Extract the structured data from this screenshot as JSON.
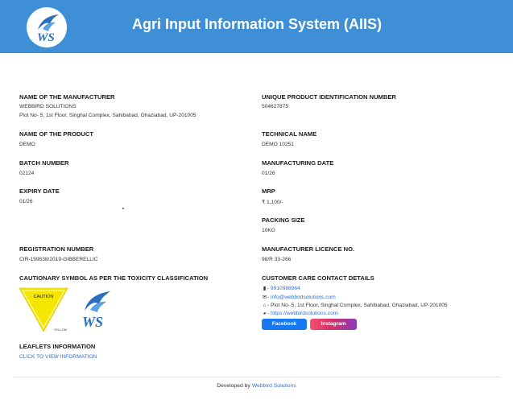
{
  "header": {
    "title": "Agri Input Information System (AIIS)"
  },
  "fields": {
    "manufacturer": {
      "label": "NAME OF THE MANUFACTURER",
      "name": "WEBBIRD SOLUTIONS",
      "address": "Plot No- 5, 1st Floor, Singhal Complex, Sahibabad, Ghaziabad, UP-201005"
    },
    "upin": {
      "label": "UNIQUE PRODUCT IDENTIFICATION NUMBER",
      "value": "504627875"
    },
    "product": {
      "label": "NAME OF THE PRODUCT",
      "value": "DEMO"
    },
    "technical": {
      "label": "TECHNICAL NAME",
      "value": "DEMO 10251"
    },
    "batch": {
      "label": "BATCH NUMBER",
      "value": "02124"
    },
    "mfg_date": {
      "label": "MANUFACTURING DATE",
      "value": "01/26"
    },
    "expiry": {
      "label": "EXPIRY DATE",
      "value": "01/26"
    },
    "mrp": {
      "label": "MRP",
      "value": "₹ 1,100/-"
    },
    "packing": {
      "label": "PACKING SIZE",
      "value": "10KG"
    },
    "registration": {
      "label": "REGISTRATION NUMBER",
      "value": "CIR-159838/2019-GIBBERELLIC"
    },
    "licence": {
      "label": "MANUFACTURER LICENCE NO.",
      "value": "98/R 33-266"
    },
    "cautionary": {
      "label": "CAUTIONARY SYMBOL AS PER THE TOXICITY CLASSIFICATION",
      "tox_top": "CAUTION",
      "tox_bottom": "YELLOW"
    },
    "contact": {
      "label": "CUSTOMER CARE CONTACT DETAILS",
      "phone": "- 9910988964",
      "email": "- info@webbirdsolutions.com",
      "address": "- Plot No- 5, 1st Floor, Singhal Complex, Sahibabad, Ghaziabad, UP-201005",
      "website": "- https://webbirdsolutions.com",
      "facebook_label": "Facebook",
      "instagram_label": "Instagram"
    },
    "leaflets": {
      "label": "LEAFLETS INFORMATION",
      "link": "CLICK TO VIEW INFORMATION"
    }
  },
  "footer": {
    "prefix": "Developed by",
    "company": "Webbird Solutions"
  },
  "colors": {
    "header_bg": "#3f8fd6",
    "link": "#2f6fd0",
    "facebook": "#1877f2",
    "toxicity_yellow": "#f5e600"
  }
}
